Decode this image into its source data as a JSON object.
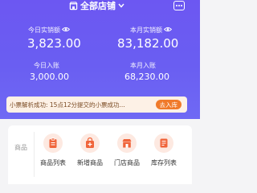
{
  "header": {
    "store_selector": "全部店铺"
  },
  "stats": {
    "today_sales_label": "今日实销额",
    "today_sales_value": "3,823.00",
    "month_sales_label": "本月实销额",
    "month_sales_value": "83,182.00",
    "today_income_label": "今日入账",
    "today_income_value": "3,000.00",
    "month_income_label": "本月入账",
    "month_income_value": "68,230.00"
  },
  "notice": {
    "text": "小票解析成功: 15点12分提交的小票成功...",
    "button_label": "去入库"
  },
  "products": {
    "section_label": "商品",
    "items": [
      {
        "label": "商品列表",
        "icon": "clipboard-icon"
      },
      {
        "label": "新增商品",
        "icon": "add-bag-icon"
      },
      {
        "label": "门店商品",
        "icon": "store-icon"
      },
      {
        "label": "库存列表",
        "icon": "list-icon"
      }
    ]
  },
  "colors": {
    "primary": "#6c5af2",
    "accent": "#f07a2a",
    "icon": "#f0643a"
  }
}
